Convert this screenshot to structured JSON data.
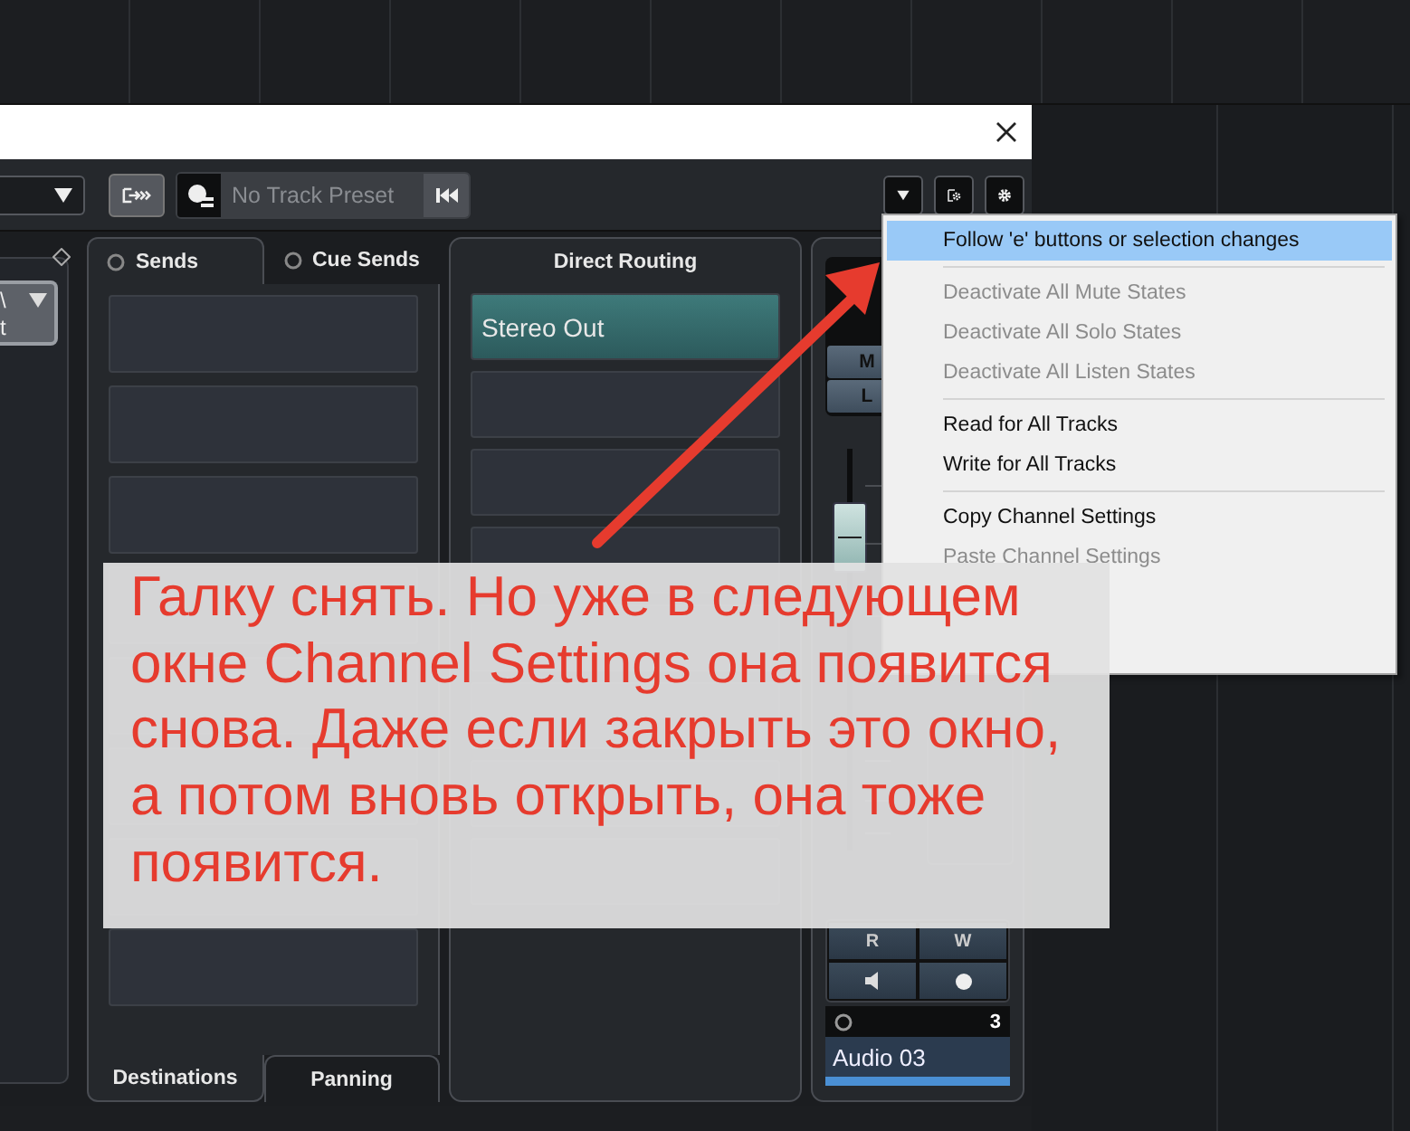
{
  "toolbar": {
    "preset": {
      "value": "No Track Preset"
    }
  },
  "left_panel": {
    "dropdown_lines": [
      "\\",
      "t"
    ]
  },
  "sends_panel": {
    "tabs": [
      {
        "label": "Sends",
        "selected": true
      },
      {
        "label": "Cue Sends",
        "selected": false
      }
    ],
    "bottom_tabs": [
      {
        "label": "Destinations",
        "selected": true
      },
      {
        "label": "Panning",
        "selected": false
      }
    ]
  },
  "routing_panel": {
    "title": "Direct Routing",
    "destinations": [
      {
        "label": "Stereo Out",
        "selected": true
      }
    ]
  },
  "channel": {
    "top_buttons": [
      "M",
      "L"
    ],
    "fader": {
      "level": 0.78
    },
    "buttons": [
      "R",
      "W"
    ],
    "number": "3",
    "name": "Audio 03"
  },
  "menu": {
    "groups": [
      {
        "items": [
          {
            "label": "Follow 'e' buttons or selection changes",
            "selected": true,
            "disabled": false
          }
        ]
      },
      {
        "items": [
          {
            "label": "Deactivate All Mute States",
            "selected": false,
            "disabled": true
          },
          {
            "label": "Deactivate All Solo States",
            "selected": false,
            "disabled": true
          },
          {
            "label": "Deactivate All Listen States",
            "selected": false,
            "disabled": true
          }
        ]
      },
      {
        "items": [
          {
            "label": "Read for All Tracks",
            "selected": false,
            "disabled": false
          },
          {
            "label": "Write for All Tracks",
            "selected": false,
            "disabled": false
          }
        ]
      },
      {
        "items": [
          {
            "label": "Copy Channel Settings",
            "selected": false,
            "disabled": false
          },
          {
            "label": "Paste Channel Settings",
            "selected": false,
            "disabled": true
          }
        ]
      }
    ]
  },
  "annotation": {
    "text": "Галку снять. Но уже в следующем окне Channel Settings она появится снова. Даже если закрыть это окно, а потом вновь открыть, она тоже появится."
  }
}
